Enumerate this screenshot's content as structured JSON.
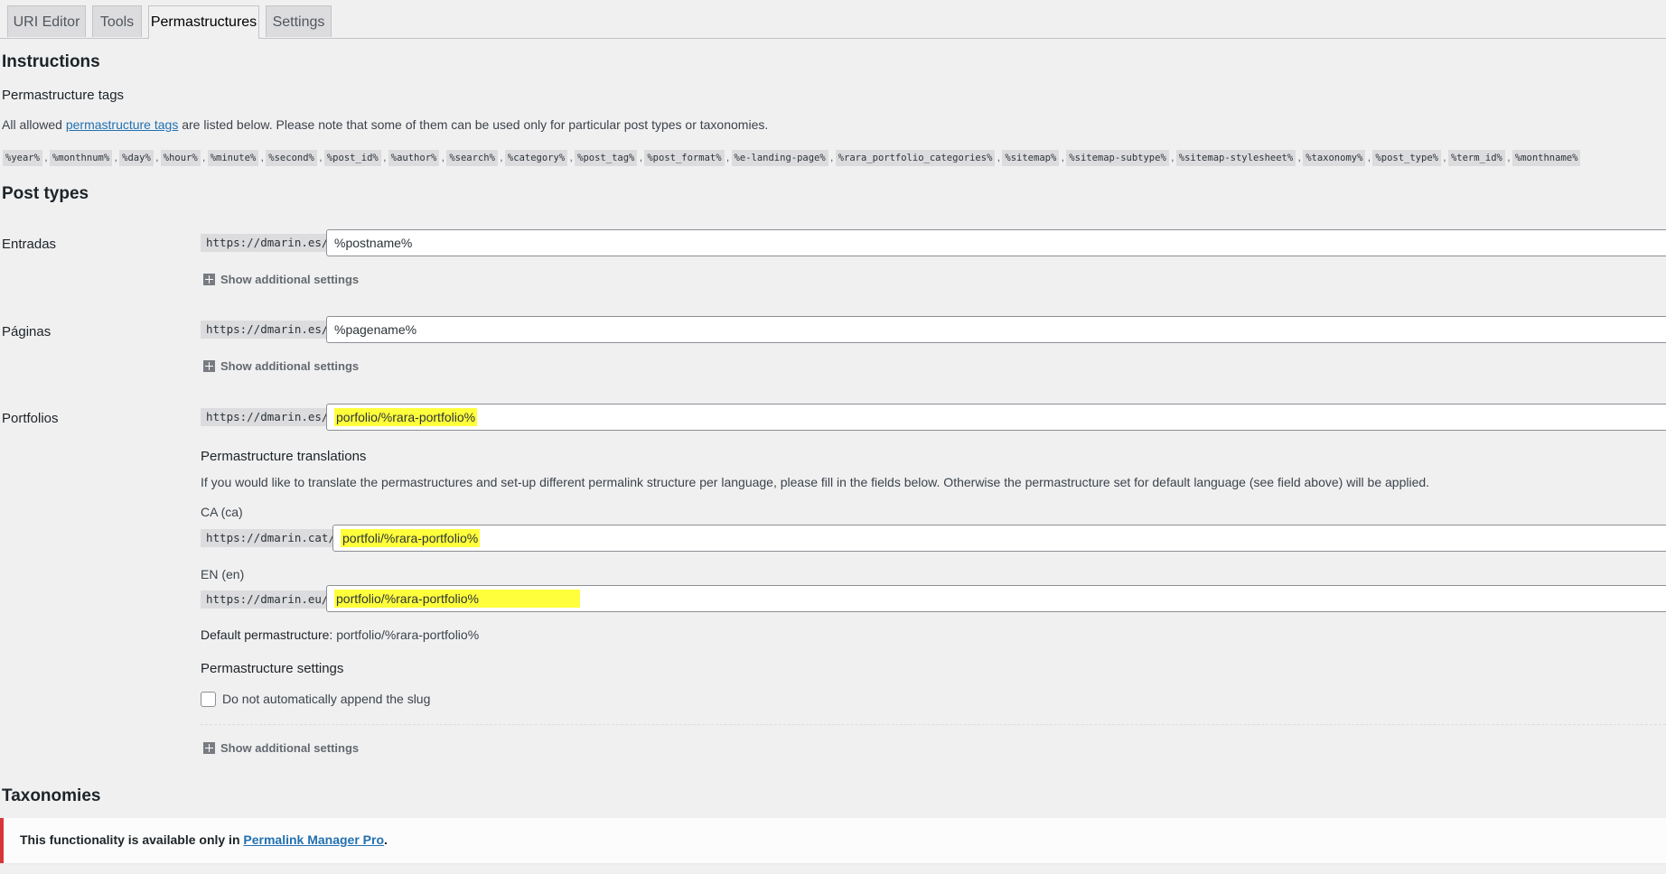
{
  "tabs": [
    {
      "label": "URI Editor"
    },
    {
      "label": "Tools"
    },
    {
      "label": "Permastructures"
    },
    {
      "label": "Settings"
    }
  ],
  "instructions": {
    "heading": "Instructions",
    "tags_heading": "Permastructure tags",
    "intro_before": "All allowed ",
    "intro_link": "permastructure tags",
    "intro_after": " are listed below. Please note that some of them can be used only for particular post types or taxonomies.",
    "tags": [
      "%year%",
      "%monthnum%",
      "%day%",
      "%hour%",
      "%minute%",
      "%second%",
      "%post_id%",
      "%author%",
      "%search%",
      "%category%",
      "%post_tag%",
      "%post_format%",
      "%e-landing-page%",
      "%rara_portfolio_categories%",
      "%sitemap%",
      "%sitemap-subtype%",
      "%sitemap-stylesheet%",
      "%taxonomy%",
      "%post_type%",
      "%term_id%",
      "%monthname%"
    ],
    "tag_separator": ","
  },
  "post_types": {
    "heading": "Post types",
    "show_additional": "Show additional settings",
    "entradas": {
      "label": "Entradas",
      "prefix": "https://dmarin.es/",
      "value": "%postname%"
    },
    "paginas": {
      "label": "Páginas",
      "prefix": "https://dmarin.es/",
      "value": "%pagename%"
    },
    "portfolios": {
      "label": "Portfolios",
      "prefix": "https://dmarin.es/",
      "value": "porfolio/%rara-portfolio%",
      "translations_heading": "Permastructure translations",
      "translations_help": "If you would like to translate the permastructures and set-up different permalink structure per language, please fill in the fields below. Otherwise the permastructure set for default language (see field above) will be applied.",
      "ca": {
        "label": "CA (ca)",
        "prefix": "https://dmarin.cat/",
        "value": "portfoli/%rara-portfolio%"
      },
      "en": {
        "label": "EN (en)",
        "prefix": "https://dmarin.eu/",
        "value": "portfolio/%rara-portfolio%"
      },
      "default_label": "Default permastructure:",
      "default_value": "portfolio/%rara-portfolio%",
      "settings_heading": "Permastructure settings",
      "no_slug_label": "Do not automatically append the slug"
    }
  },
  "taxonomies": {
    "heading": "Taxonomies",
    "notice_before": "This functionality is available only in ",
    "notice_link": "Permalink Manager Pro",
    "notice_after": "."
  },
  "colors": {
    "accent": "#2271b1",
    "highlight": "#ffff3c",
    "error": "#d63638"
  }
}
